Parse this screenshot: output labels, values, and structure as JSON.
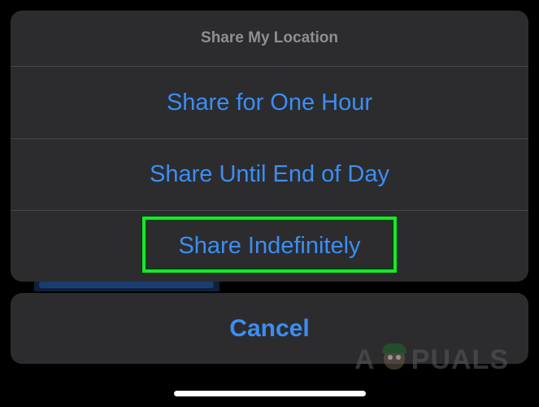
{
  "action_sheet": {
    "title": "Share My Location",
    "options": [
      {
        "label": "Share for One Hour"
      },
      {
        "label": "Share Until End of Day"
      },
      {
        "label": "Share Indefinitely",
        "highlighted": true
      }
    ],
    "highlight_color": "#19e62c"
  },
  "cancel": {
    "label": "Cancel"
  },
  "watermark": {
    "text_left": "A",
    "text_right": "PUALS",
    "mascot_icon": "appuals-mascot-icon"
  },
  "colors": {
    "sheet_background": "#2c2c2e",
    "action_text": "#3b8ef5",
    "title_text": "#8e8e93",
    "separator": "#48484a"
  }
}
